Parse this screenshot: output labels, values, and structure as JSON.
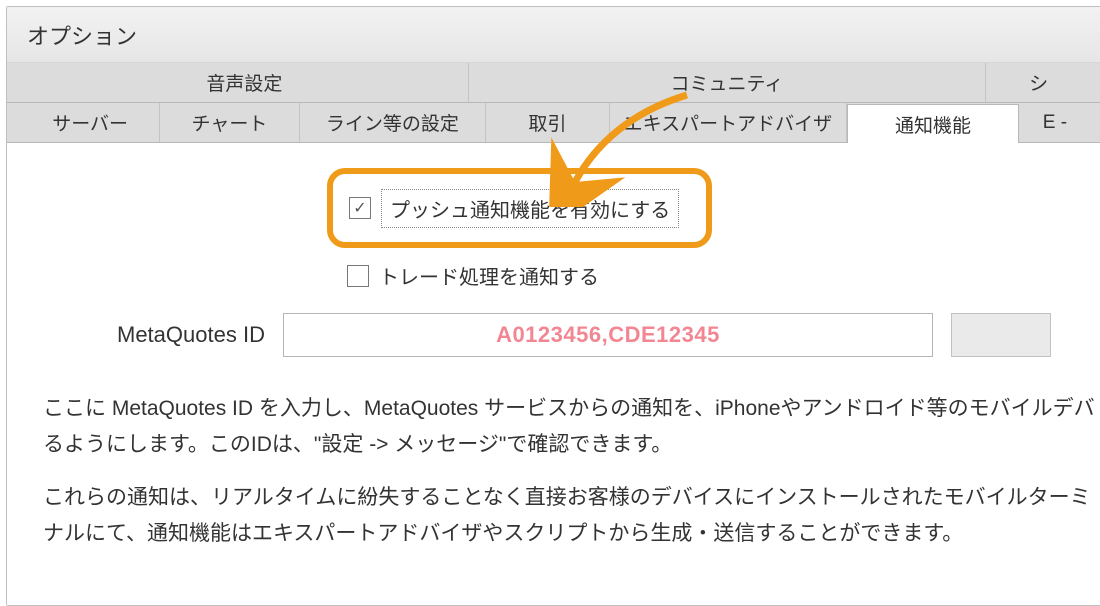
{
  "dialog": {
    "title": "オプション"
  },
  "tabs_row1": [
    "音声設定",
    "コミュニティ",
    "シ"
  ],
  "tabs_row2": [
    "サーバー",
    "チャート",
    "ライン等の設定",
    "取引",
    "エキスパートアドバイザ",
    "通知機能",
    "E -"
  ],
  "active_tab": "通知機能",
  "options": {
    "push_enable": {
      "label": "プッシュ通知機能を有効にする",
      "checked": true
    },
    "trade_notify": {
      "label": "トレード処理を通知する",
      "checked": false
    }
  },
  "mq_id": {
    "label": "MetaQuotes ID",
    "value": "A0123456,CDE12345"
  },
  "help": {
    "p1": "ここに MetaQuotes ID を入力し、MetaQuotes サービスからの通知を、iPhoneやアンドロイド等のモバイルデバるようにします。このIDは、\"設定 -> メッセージ\"で確認できます。",
    "p2": "これらの通知は、リアルタイムに紛失することなく直接お客様のデバイスにインストールされたモバイルターミナルにて、通知機能はエキスパートアドバイザやスクリプトから生成・送信することができます。"
  },
  "colors": {
    "highlight": "#f09a1a",
    "id_text": "#f28693"
  }
}
